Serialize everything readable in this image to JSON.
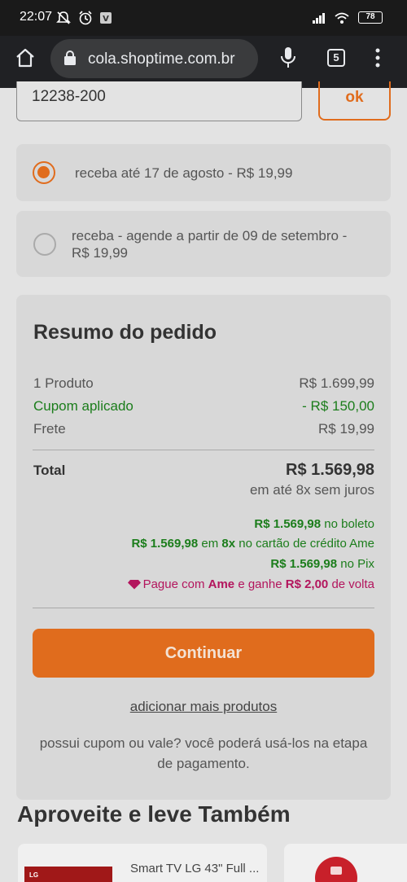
{
  "status_bar": {
    "time": "22:07",
    "battery": "78"
  },
  "browser": {
    "url": "cola.shoptime.com.br",
    "tab_count": "5"
  },
  "cep": {
    "value": "12238-200",
    "ok_label": "ok"
  },
  "shipping_options": [
    {
      "label": "receba até 17 de agosto - R$ 19,99",
      "selected": true
    },
    {
      "label_line1": "receba - agende a partir de 09 de setembro -",
      "label_line2": "R$ 19,99",
      "selected": false
    }
  ],
  "summary": {
    "title": "Resumo do pedido",
    "products_label": "1 Produto",
    "products_value": "R$ 1.699,99",
    "coupon_label": "Cupom aplicado",
    "coupon_value": "- R$ 150,00",
    "shipping_label": "Frete",
    "shipping_value": "R$ 19,99",
    "total_label": "Total",
    "total_value": "R$ 1.569,98",
    "installments": "em até 8x sem juros",
    "boleto_amount": "R$ 1.569,98",
    "boleto_text": "no boleto",
    "card_amount": "R$ 1.569,98",
    "card_mid": "em",
    "card_installments": "8x",
    "card_text": "no cartão de crédito Ame",
    "pix_amount": "R$ 1.569,98",
    "pix_text": "no Pix",
    "ame_prefix": "Pague com",
    "ame_brand": "Ame",
    "ame_mid": "e ganhe",
    "ame_amount": "R$ 2,00",
    "ame_suffix": "de volta",
    "continue_label": "Continuar",
    "add_more_label": "adicionar mais produtos",
    "coupon_note_line1": "possui cupom ou vale? você poderá usá-los na etapa",
    "coupon_note_line2": "de pagamento."
  },
  "also_take": {
    "title": "Aproveite e leve Também",
    "products": [
      {
        "name": "Smart TV LG 43\" Full ..."
      }
    ]
  },
  "colors": {
    "accent": "#e06c1d",
    "green": "#1b7d1b",
    "ame": "#b3155d"
  }
}
